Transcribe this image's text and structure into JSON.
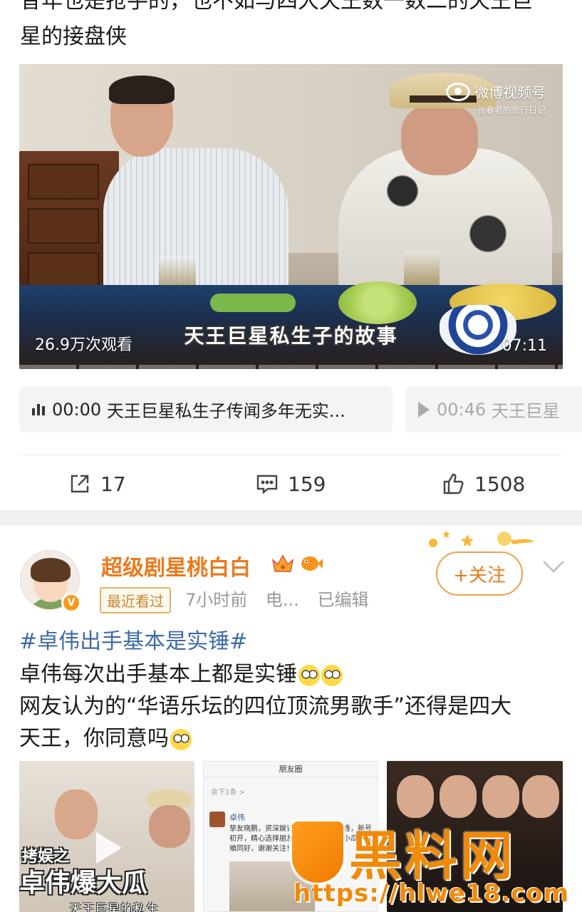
{
  "post1": {
    "text_line_cut": "昔年也是抢手的，也不如与四大天王数一数二的天王巨",
    "text_line2": "星的接盘侠",
    "video": {
      "watermark_brand": "微博视频号",
      "watermark_sub": "张春君的旅行日记",
      "subtitle": "天王巨星私生子的故事",
      "views": "26.9万次观看",
      "duration": "07:11"
    },
    "chapters": [
      {
        "time": "00:00",
        "title": "天王巨星私生子传闻多年无实..."
      },
      {
        "time": "00:46",
        "title": "天王巨星"
      }
    ],
    "actions": {
      "share": "17",
      "comment": "159",
      "like": "1508"
    }
  },
  "post2": {
    "username": "超级剧星桃白白",
    "recent_badge": "最近看过",
    "time": "7小时前",
    "source": "电...",
    "edited": "已编辑",
    "follow_label": "+关注",
    "topic": "#卓伟出手基本是实锤#",
    "body_lines": [
      "卓伟每次出手基本上都是实锤",
      "网友认为的“华语乐坛的四位顶流男歌手”还得是四大",
      "天王，你同意吗"
    ],
    "thumb1": {
      "cap_small": "拷娱之",
      "cap_big": "卓伟爆大瓜",
      "cap_bottom": "天王巨星的私生"
    },
    "thumb2": {
      "header": "朋友圈",
      "sub": "余下1条 >",
      "name": "卓伟",
      "text": "挚友晓鹏，资深娱记，仗义直，出身香，新号初开，精心选择朋友应友所邀，出身小瓜，以飨同好，谢谢关注！"
    }
  },
  "watermark": {
    "text": "黑料网",
    "url": "https://hlwe18.com"
  },
  "colors": {
    "accent": "#eb7a1c",
    "topic": "#3d6aa8",
    "watermark": "#f08a0a"
  }
}
